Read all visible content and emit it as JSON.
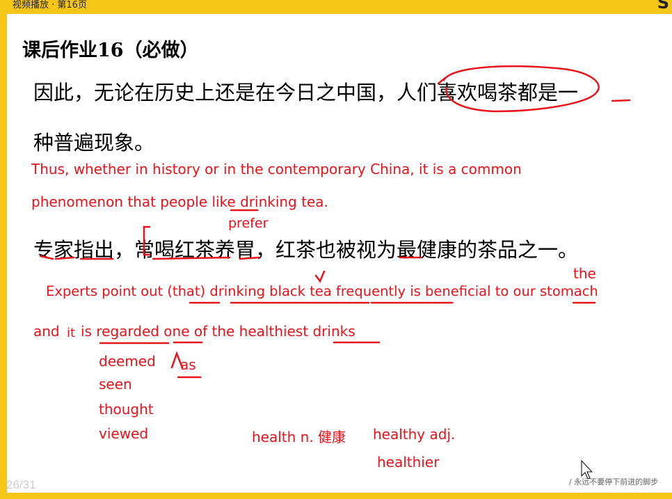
{
  "window": {
    "title": "视频播放 · 第16页",
    "logo": "S"
  },
  "slide": {
    "heading": "课后作业16（必做）",
    "para1_line1": "因此，无论在历史上还是在今日之中国，人们喜欢喝茶都是一",
    "para1_line2": "种普遍现象。",
    "trans1_line1": "Thus, whether in history or in the contemporary China, it is a common",
    "trans1_line2": "phenomenon that people like drinking tea.",
    "note_prefer": "prefer",
    "para2": "专家指出，常喝红茶养胃，红茶也被视为最健康的茶品之一。",
    "note_the": "the",
    "trans2_line1": "Experts point out (that) drinking black tea frequently is beneficial to our stomach",
    "trans2_and": "and",
    "trans2_it": "it",
    "trans2_rest": "is regarded one of the healthiest drinks",
    "note_as": "as",
    "synonyms": [
      "deemed",
      "seen",
      "thought",
      "viewed"
    ],
    "vocab_health": "health n. 健康",
    "vocab_healthy": "healthy adj.",
    "vocab_healthier": "healthier"
  },
  "footer": {
    "page_indicator": "26/31",
    "slogan": "/ 永远不要停下前进的脚步"
  },
  "colors": {
    "accent_yellow": "#F5C518",
    "annotation_red": "#E8141B"
  }
}
